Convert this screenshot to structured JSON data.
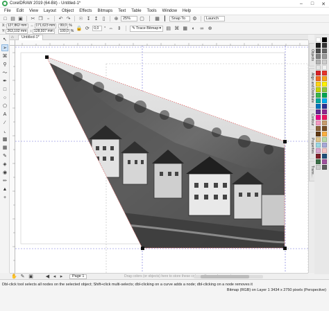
{
  "window": {
    "title": "CorelDRAW 2019 (64-Bit) - Untitled-1*",
    "minimize": "–",
    "maximize": "□",
    "close": "✕"
  },
  "menu": [
    "File",
    "Edit",
    "View",
    "Layout",
    "Object",
    "Effects",
    "Bitmaps",
    "Text",
    "Table",
    "Tools",
    "Window",
    "Help"
  ],
  "standard_toolbar": {
    "zoom": "25%",
    "snap_to": "Snap To",
    "launch": "Launch"
  },
  "property_bar": {
    "x_label": "X:",
    "x_value": "127,862 mm",
    "y_label": "Y:",
    "y_value": "263,102 mm",
    "width_value": "171,623 mm",
    "height_value": "128,937 mm",
    "scale_x": "99,0",
    "scale_y": "100,0",
    "scale_unit": "%",
    "rotation": "0,0",
    "rotation_unit": "°",
    "trace_bitmap": "Trace Bitmap"
  },
  "document_tab": "Untitled-1*",
  "dockers": [
    "Objects",
    "Align and Distribute",
    "Contour",
    "Properties",
    "Trans..."
  ],
  "page_tab": "Page 1",
  "canvas_hint": "Drag colors (or objects) here to store these colors with your document",
  "status": {
    "hint": "Dbl-click tool selects all nodes on the selected object; Shift+click multi-selects; dbl-clicking on a curve adds a node; dbl-clicking on a node removes it",
    "object_info": "Bitmap (RGB) on Layer 1 3434 x 2750 pixels (Perspective)"
  },
  "palette_colors": [
    "#ffffff",
    "#000000",
    "#1a1a1a",
    "#333333",
    "#4d4d4d",
    "#666666",
    "#808080",
    "#999999",
    "#b3b3b3",
    "#cccccc",
    "#e6e6e6",
    "#f2f2f2",
    "#d92027",
    "#e6352b",
    "#f06a25",
    "#f8a51c",
    "#fcd116",
    "#fff200",
    "#c8d400",
    "#8dc63f",
    "#39b54a",
    "#00a651",
    "#00a99d",
    "#00aeef",
    "#0072bc",
    "#2e3192",
    "#662d91",
    "#92278f",
    "#ec008c",
    "#ed145b",
    "#f49ac2",
    "#c69c6d",
    "#8c6239",
    "#754c24",
    "#603913",
    "#fbb040",
    "#e0c48b",
    "#b7d9a6",
    "#9ad8e3",
    "#a7a9d8",
    "#d9a6cf",
    "#f4c2c2",
    "#7f1f2a",
    "#1f4e79",
    "#3c6e47",
    "#a04f9d",
    "#d0d0d0",
    "#5c5c5c"
  ]
}
